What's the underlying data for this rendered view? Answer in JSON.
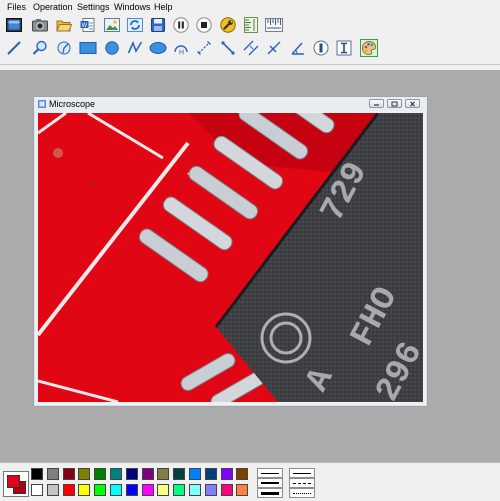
{
  "menu": [
    "Files",
    "Operation",
    "Settings",
    "Windows",
    "Help"
  ],
  "toolbar": {
    "row1": [
      "live-video-icon",
      "camera-icon",
      "open-folder-icon",
      "export-document-icon",
      "image-editor-icon",
      "refresh-icon",
      "save-icon",
      "pause-icon",
      "stop-icon",
      "settings-wrench-icon",
      "vertical-ruler-icon",
      "horizontal-ruler-icon"
    ],
    "row2": [
      "line-tool-icon",
      "zoom-icon",
      "angle-arc-icon",
      "rectangle-tool-icon",
      "circle-tool-icon",
      "polyline-tool-icon",
      "ellipse-tool-icon",
      "arc-height-icon",
      "dimension-line-icon",
      "point-distance-icon",
      "parallel-line-icon",
      "perpendicular-icon",
      "angle-tool-icon",
      "text-marker-icon",
      "calibration-icon",
      "spacing-tool-icon",
      "color-palette-icon"
    ]
  },
  "window": {
    "title": "Microscope"
  },
  "palette": {
    "primary": "#e3001b",
    "secondary": "#b3000e",
    "row1": [
      "#000000",
      "#7f7f7f",
      "#880015",
      "#808000",
      "#008000",
      "#008080",
      "#000080",
      "#800080",
      "#808040",
      "#004040",
      "#0080ff",
      "#004080",
      "#8000ff",
      "#804000"
    ],
    "row2": [
      "#ffffff",
      "#c3c3c3",
      "#ff0000",
      "#ffff00",
      "#00ff00",
      "#00ffff",
      "#0000ff",
      "#ff00ff",
      "#ffff80",
      "#00ff80",
      "#80ffff",
      "#8080ff",
      "#ff0080",
      "#ff8040"
    ]
  },
  "line_styles": [
    "thin-line",
    "medium-line",
    "thick-line",
    "solid-line",
    "dashed-line",
    "dash-dot-line"
  ]
}
